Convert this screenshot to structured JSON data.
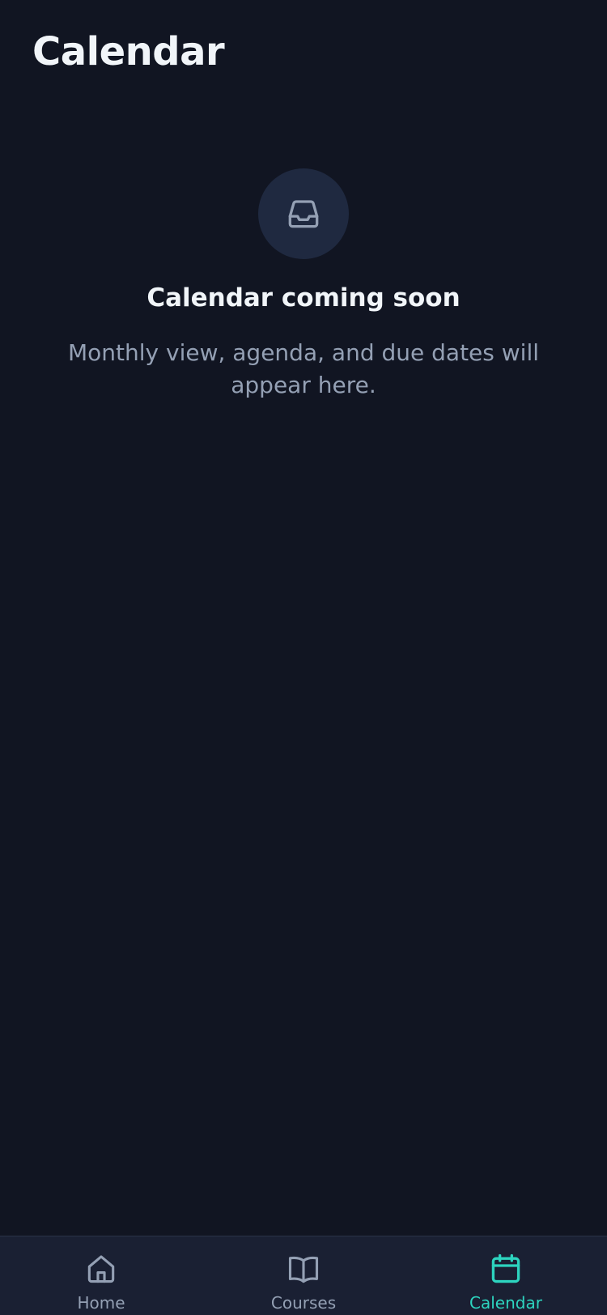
{
  "header": {
    "title": "Calendar"
  },
  "empty_state": {
    "icon": "inbox-icon",
    "title": "Calendar coming soon",
    "description": "Monthly view, agenda, and due dates will appear here."
  },
  "tab_bar": {
    "active": "calendar",
    "items": [
      {
        "id": "home",
        "label": "Home",
        "icon": "home-icon"
      },
      {
        "id": "courses",
        "label": "Courses",
        "icon": "book-open-icon"
      },
      {
        "id": "calendar",
        "label": "Calendar",
        "icon": "calendar-icon"
      }
    ]
  },
  "colors": {
    "background": "#111522",
    "surface": "#1a2033",
    "icon_circle": "#1f2940",
    "text_primary": "#f1f5f9",
    "text_secondary": "#94a0b4",
    "accent": "#2dd4bf"
  }
}
